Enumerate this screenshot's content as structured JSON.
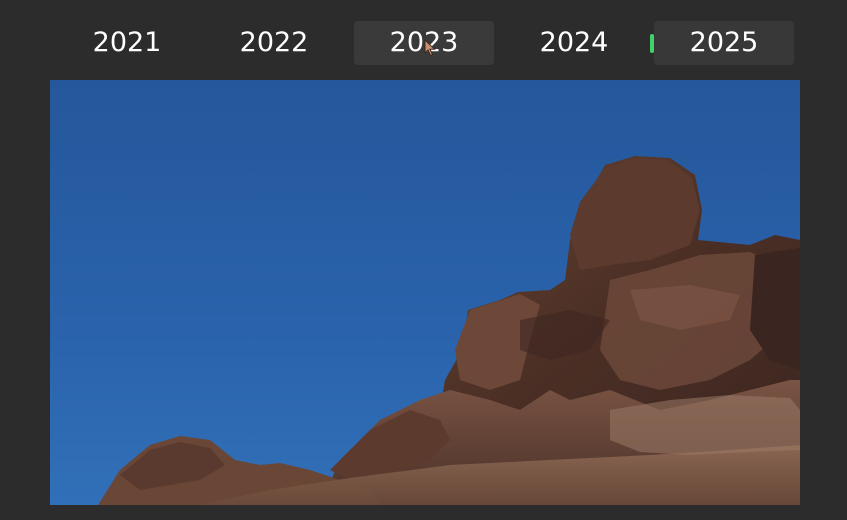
{
  "tabs": [
    {
      "label": "2021",
      "state": "normal"
    },
    {
      "label": "2022",
      "state": "normal"
    },
    {
      "label": "2023",
      "state": "hovered"
    },
    {
      "label": "2024",
      "state": "normal"
    },
    {
      "label": "2025",
      "state": "selected"
    }
  ],
  "colors": {
    "background": "#2c2c2c",
    "tab_text": "#ffffff",
    "hover_bg": "#3a3a3a",
    "selected_bg": "#383838",
    "selection_indicator": "#3fd36a",
    "sky": "#2a5fa5",
    "rock": "#5a3a2c"
  },
  "icons": {
    "cursor": "arrow-cursor-icon"
  }
}
